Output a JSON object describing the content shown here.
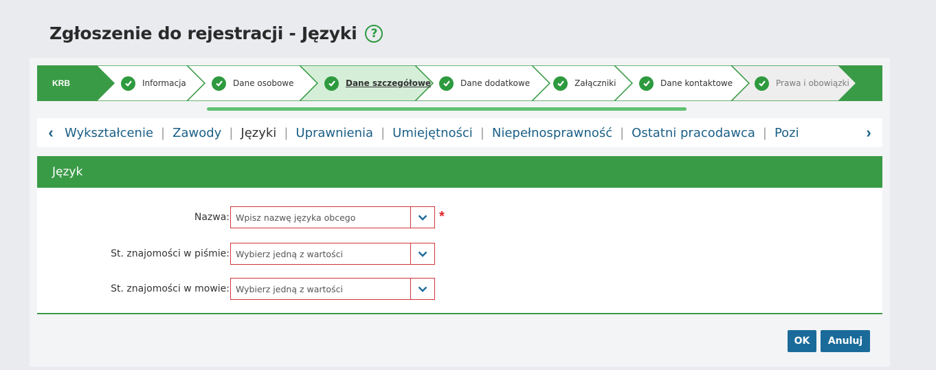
{
  "header": {
    "title": "Zgłoszenie do rejestracji - Języki",
    "help_glyph": "?"
  },
  "stepper": {
    "krb": "KRB",
    "steps": [
      {
        "label": "Informacja",
        "state": "done"
      },
      {
        "label": "Dane osobowe",
        "state": "done"
      },
      {
        "label": "Dane szczegółowe",
        "state": "active"
      },
      {
        "label": "Dane dodatkowe",
        "state": "done"
      },
      {
        "label": "Załączniki",
        "state": "done"
      },
      {
        "label": "Dane kontaktowe",
        "state": "done"
      },
      {
        "label": "Prawa i obowiązki",
        "state": "faded"
      }
    ]
  },
  "subnav": {
    "prev": "‹",
    "next": "›",
    "items": [
      {
        "label": "Wykształcenie",
        "current": false
      },
      {
        "label": "Zawody",
        "current": false
      },
      {
        "label": "Języki",
        "current": true
      },
      {
        "label": "Uprawnienia",
        "current": false
      },
      {
        "label": "Umiejętności",
        "current": false
      },
      {
        "label": "Niepełnosprawność",
        "current": false
      },
      {
        "label": "Ostatni pracodawca",
        "current": false
      },
      {
        "label": "Pozi",
        "current": false
      }
    ]
  },
  "section": {
    "title": "Język",
    "fields": [
      {
        "label": "Nazwa:",
        "placeholder": "Wpisz nazwę języka obcego",
        "required": true
      },
      {
        "label": "St. znajomości w piśmie:",
        "placeholder": "Wybierz jedną z wartości",
        "required": false
      },
      {
        "label": "St. znajomości w mowie:",
        "placeholder": "Wybierz jedną z wartości",
        "required": false
      }
    ],
    "required_marker": "*"
  },
  "buttons": {
    "ok": "OK",
    "cancel": "Anuluj"
  },
  "colors": {
    "green": "#3a9b46",
    "blue": "#1a6b9a",
    "red": "#d0343a"
  }
}
